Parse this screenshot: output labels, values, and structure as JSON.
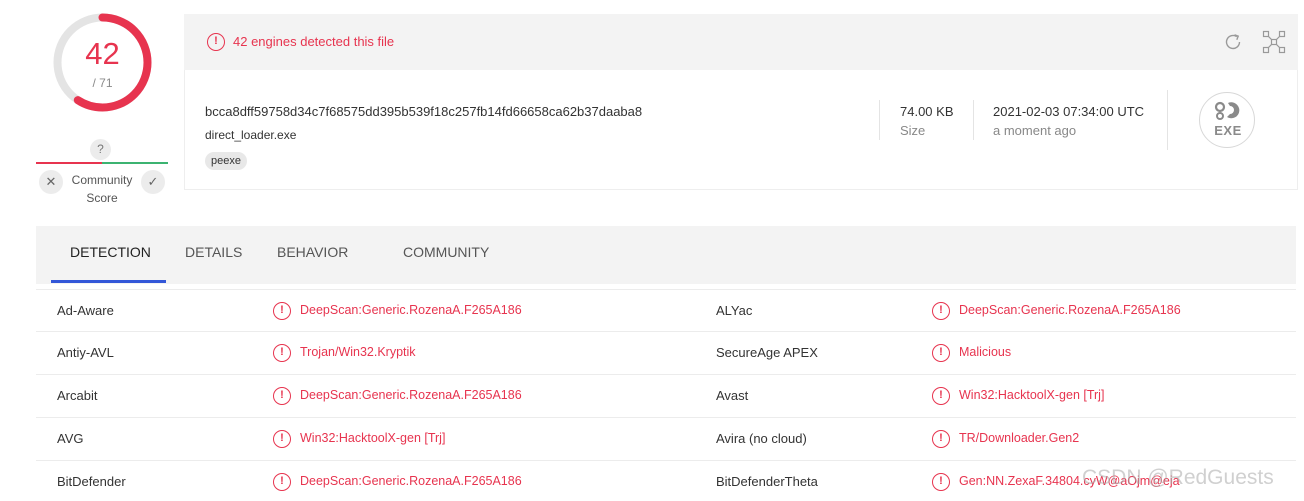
{
  "score": {
    "detected": "42",
    "total": "/ 71",
    "detected_fraction": 0.5915,
    "color": "#e7344f"
  },
  "community": {
    "question": "?",
    "dislike": "✕",
    "like": "✓",
    "label_line1": "Community",
    "label_line2": "Score"
  },
  "alert": {
    "icon": "!",
    "text": "42 engines detected this file"
  },
  "toolbar": {
    "reload_icon": "reload-icon",
    "expand_icon": "graph-icon"
  },
  "file": {
    "hash": "bcca8dff59758d34c7f68575dd395b539f18c257fb14fd66658ca62b37daaba8",
    "name": "direct_loader.exe",
    "tag": "peexe",
    "size_value": "74.00 KB",
    "size_label": "Size",
    "date_value": "2021-02-03 07:34:00 UTC",
    "date_label": "a moment ago",
    "type_icon_text": "EXE"
  },
  "tabs": [
    {
      "label": "DETECTION",
      "active": true
    },
    {
      "label": "DETAILS",
      "active": false
    },
    {
      "label": "BEHAVIOR",
      "active": false
    },
    {
      "label": "COMMUNITY",
      "active": false
    }
  ],
  "detections": [
    {
      "engine_left": "Ad-Aware",
      "result_left": "DeepScan:Generic.RozenaA.F265A186",
      "engine_right": "ALYac",
      "result_right": "DeepScan:Generic.RozenaA.F265A186"
    },
    {
      "engine_left": "Antiy-AVL",
      "result_left": "Trojan/Win32.Kryptik",
      "engine_right": "SecureAge APEX",
      "result_right": "Malicious"
    },
    {
      "engine_left": "Arcabit",
      "result_left": "DeepScan:Generic.RozenaA.F265A186",
      "engine_right": "Avast",
      "result_right": "Win32:HacktoolX-gen [Trj]"
    },
    {
      "engine_left": "AVG",
      "result_left": "Win32:HacktoolX-gen [Trj]",
      "engine_right": "Avira (no cloud)",
      "result_right": "TR/Downloader.Gen2"
    },
    {
      "engine_left": "BitDefender",
      "result_left": "DeepScan:Generic.RozenaA.F265A186",
      "engine_right": "BitDefenderTheta",
      "result_right": "Gen:NN.ZexaF.34804.cyW@aOjm@eja"
    }
  ],
  "watermark": "CSDN @RedGuests"
}
